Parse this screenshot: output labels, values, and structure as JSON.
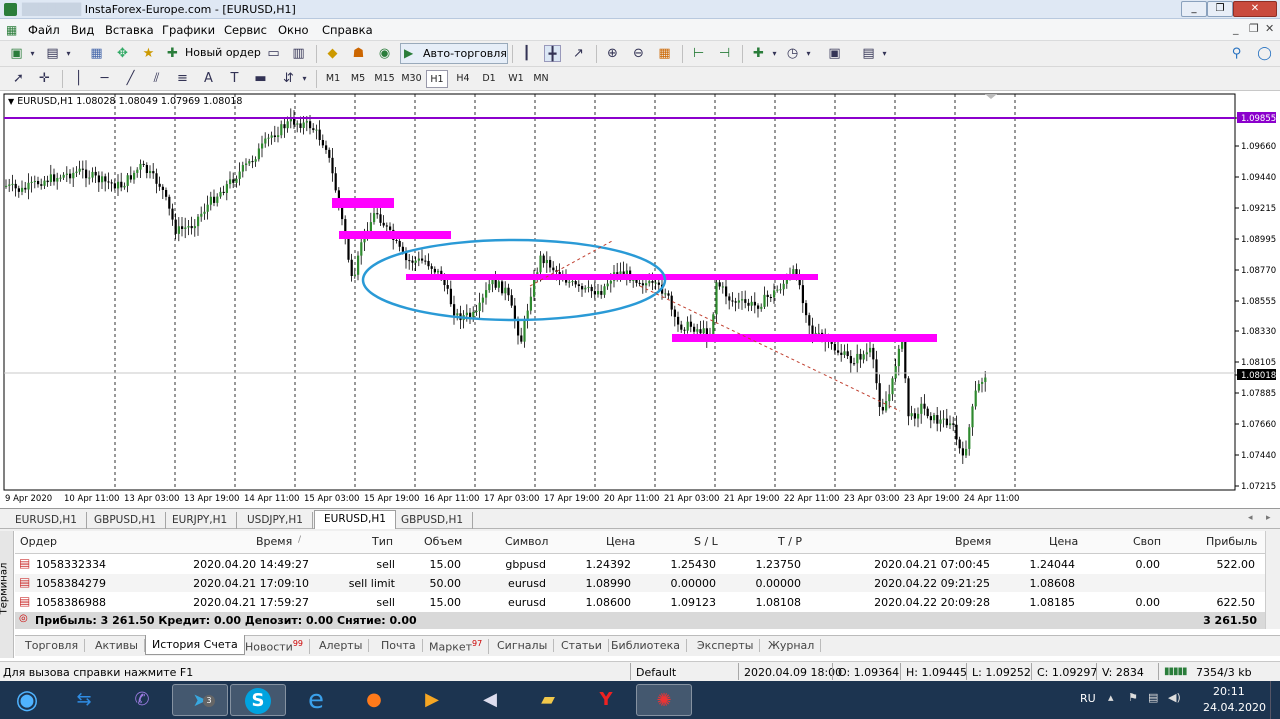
{
  "window": {
    "title_redacted": "███████",
    "title": "InstaForex-Europe.com - [EURUSD,H1]",
    "controls": [
      "_",
      "❐",
      "✕"
    ]
  },
  "menu": [
    "Файл",
    "Вид",
    "Вставка",
    "Графики",
    "Сервис",
    "Окно",
    "Справка"
  ],
  "toolbar": {
    "new_order_label": "Новый ордер",
    "autotrade_label": "Авто-торговля"
  },
  "timeframes": [
    "M1",
    "M5",
    "M15",
    "M30",
    "H1",
    "H4",
    "D1",
    "W1",
    "MN"
  ],
  "timeframe_selected": "H1",
  "chart": {
    "header": "EURUSD,H1  1.08028 1.08049 1.07969 1.08018",
    "price_levels": [
      "1.09855",
      "1.09660",
      "1.09440",
      "1.09215",
      "1.08995",
      "1.08770",
      "1.08555",
      "1.08330",
      "1.08105",
      "1.08018",
      "1.07885",
      "1.07660",
      "1.07440",
      "1.07215"
    ],
    "current_price": "1.08018",
    "line_price": "1.09855",
    "time_labels": [
      "9 Apr 2020",
      "10 Apr 11:00",
      "13 Apr 03:00",
      "13 Apr 19:00",
      "14 Apr 11:00",
      "15 Apr 03:00",
      "15 Apr 19:00",
      "16 Apr 11:00",
      "17 Apr 03:00",
      "17 Apr 19:00",
      "20 Apr 11:00",
      "21 Apr 03:00",
      "21 Apr 19:00",
      "22 Apr 11:00",
      "23 Apr 03:00",
      "23 Apr 19:00",
      "24 Apr 11:00"
    ],
    "colors": {
      "bull": "#2f8a2f",
      "bear": "#000000",
      "level_line": "#8b00cc",
      "zones": "#ff00ff",
      "ellipse": "#2a9ad6",
      "grid": "#000000"
    }
  },
  "chart_tabs": [
    "EURUSD,H1",
    "GBPUSD,H1",
    "EURJPY,H1",
    "USDJPY,H1",
    "EURUSD,H1",
    "GBPUSD,H1"
  ],
  "chart_tab_active": 4,
  "terminal": {
    "side_label": "Терминал",
    "headers": {
      "order": "Ордер",
      "time": "Время",
      "type": "Тип",
      "volume": "Объем",
      "symbol": "Символ",
      "price": "Цена",
      "sl": "S / L",
      "tp": "T / P",
      "close_time": "Время",
      "close_price": "Цена",
      "swap": "Своп",
      "profit": "Прибыль"
    },
    "rows": [
      {
        "order": "1058332334",
        "time": "2020.04.20 14:49:27",
        "type": "sell",
        "volume": "15.00",
        "symbol": "gbpusd",
        "price": "1.24392",
        "sl": "1.25430",
        "tp": "1.23750",
        "close_time": "2020.04.21 07:00:45",
        "close_price": "1.24044",
        "swap": "0.00",
        "profit": "522.00"
      },
      {
        "order": "1058384279",
        "time": "2020.04.21 17:09:10",
        "type": "sell limit",
        "volume": "50.00",
        "symbol": "eurusd",
        "price": "1.08990",
        "sl": "0.00000",
        "tp": "0.00000",
        "close_time": "2020.04.22 09:21:25",
        "close_price": "1.08608",
        "swap": "",
        "profit": ""
      },
      {
        "order": "1058386988",
        "time": "2020.04.21 17:59:27",
        "type": "sell",
        "volume": "15.00",
        "symbol": "eurusd",
        "price": "1.08600",
        "sl": "1.09123",
        "tp": "1.08108",
        "close_time": "2020.04.22 20:09:28",
        "close_price": "1.08185",
        "swap": "0.00",
        "profit": "622.50"
      }
    ],
    "summary": "Прибыль: 3 261.50  Кредит: 0.00  Депозит: 0.00  Снятие: 0.00",
    "summary_total": "3 261.50",
    "tabs": [
      {
        "label": "Торговля",
        "badge": ""
      },
      {
        "label": "Активы",
        "badge": ""
      },
      {
        "label": "История Счета",
        "badge": ""
      },
      {
        "label": "Новости",
        "badge": "99"
      },
      {
        "label": "Алерты",
        "badge": ""
      },
      {
        "label": "Почта",
        "badge": ""
      },
      {
        "label": "Маркет",
        "badge": "97"
      },
      {
        "label": "Сигналы",
        "badge": ""
      },
      {
        "label": "Статьи",
        "badge": ""
      },
      {
        "label": "Библиотека",
        "badge": ""
      },
      {
        "label": "Эксперты",
        "badge": ""
      },
      {
        "label": "Журнал",
        "badge": ""
      }
    ],
    "tab_active": 2
  },
  "status": {
    "help": "Для вызова справки нажмите F1",
    "profile": "Default",
    "datetime": "2020.04.09 18:00",
    "open": "O: 1.09364",
    "high": "H: 1.09445",
    "low": "L: 1.09252",
    "close": "C: 1.09297",
    "volume": "V: 2834",
    "traffic": "7354/3 kb"
  },
  "taskbar": {
    "lang": "RU",
    "time": "20:11",
    "date": "24.04.2020",
    "telegram_badge": "3",
    "apps": [
      "start-button",
      "teamviewer",
      "viber",
      "telegram",
      "skype",
      "internet-explorer",
      "firefox",
      "media-player",
      "audio",
      "file-explorer",
      "yandex-browser",
      "metatrader"
    ]
  }
}
